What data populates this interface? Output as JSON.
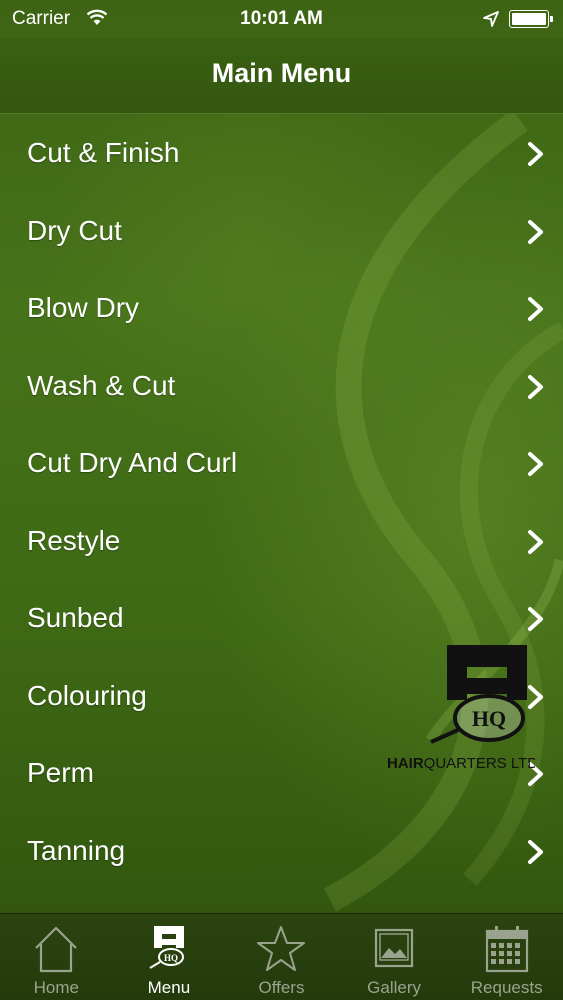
{
  "status_bar": {
    "carrier": "Carrier",
    "time": "10:01 AM"
  },
  "nav": {
    "title": "Main Menu"
  },
  "menu": {
    "items": [
      {
        "label": "Cut & Finish"
      },
      {
        "label": "Dry Cut"
      },
      {
        "label": "Blow Dry"
      },
      {
        "label": "Wash & Cut"
      },
      {
        "label": "Cut Dry And Curl"
      },
      {
        "label": "Restyle"
      },
      {
        "label": "Sunbed"
      },
      {
        "label": "Colouring"
      },
      {
        "label": "Perm"
      },
      {
        "label": "Tanning"
      }
    ]
  },
  "logo": {
    "text_bold": "HAIR",
    "text_rest": "QUARTERS LTD",
    "monogram": "HQ"
  },
  "tab_bar": {
    "active": "Menu",
    "tabs": [
      {
        "label": "Home",
        "icon": "home-icon"
      },
      {
        "label": "Menu",
        "icon": "hq-logo-icon"
      },
      {
        "label": "Offers",
        "icon": "star-icon"
      },
      {
        "label": "Gallery",
        "icon": "picture-icon"
      },
      {
        "label": "Requests",
        "icon": "calendar-icon"
      }
    ]
  },
  "colors": {
    "background": "#46721a",
    "nav_bar": "#3a6112",
    "tab_bar": "#243a0c",
    "tab_inactive": "#9aa38e",
    "text": "#ffffff"
  }
}
